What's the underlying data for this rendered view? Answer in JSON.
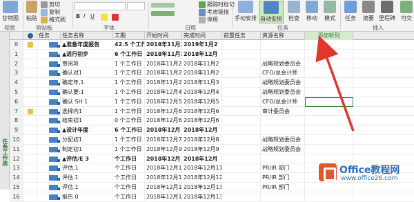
{
  "ribbon": {
    "gantt_label": "甘特图",
    "paste_label": "粘贴",
    "cut_label": "剪切",
    "copy_label": "复制",
    "format_painter_label": "格式刷",
    "group_view": "视图",
    "group_clipboard": "剪贴板",
    "group_font": "字体",
    "group_schedule": "日程",
    "group_tasks": "任务",
    "group_insert": "插入",
    "mark_on_track": "跟踪时标记",
    "respect_links": "考虑链接",
    "inactivate": "停用",
    "manual_schedule": "手动安排",
    "auto_schedule": "自动安排",
    "inspect": "检查",
    "move": "移动",
    "mode": "模式",
    "task": "任务",
    "summary": "摘要",
    "milestone": "里程碑",
    "deliverable": "可交"
  },
  "grid": {
    "headers": {
      "mode": "任务",
      "name": "任务名称",
      "duration": "工期",
      "start": "开始时间",
      "finish": "完成时间",
      "predecessors": "前置任务",
      "resource": "资源名称",
      "add_column": "添加新列"
    },
    "side_label": "任务工作表",
    "rows": [
      {
        "num": "0",
        "name": "▲准备年度报告",
        "dur": "42.5 个工作日",
        "start": "2018年11月2",
        "finish": "2019年1月2",
        "pred": "",
        "res": "",
        "summary": true
      },
      {
        "num": "1",
        "name": "▲进行初步",
        "dur": "6 个工作日",
        "start": "2018年11月2",
        "finish": "2018年12月",
        "pred": "",
        "res": "",
        "summary": true
      },
      {
        "num": "2",
        "name": "审阅项",
        "dur": "1 个工作日",
        "start": "2018年11月2",
        "finish": "2018年11月2",
        "pred": "",
        "res": "战略规划委员会",
        "summary": false
      },
      {
        "num": "3",
        "name": "确认对1",
        "dur": "1 个工作日",
        "start": "2018年11月2",
        "finish": "2018年11月2",
        "pred": "",
        "res": "CFO/总会计师",
        "summary": false
      },
      {
        "num": "4",
        "name": "确定年,1",
        "dur": "1 个工作日",
        "start": "2018年11月2",
        "finish": "2018年11月3",
        "pred": "",
        "res": "战略规划委员会",
        "summary": false
      },
      {
        "num": "5",
        "name": "确认要:1",
        "dur": "1 个工作日",
        "start": "2018年12月4",
        "finish": "2018年12月4",
        "pred": "",
        "res": "战略规划委员会",
        "summary": false
      },
      {
        "num": "6",
        "name": "确认 SH 1",
        "dur": "1 个工作日",
        "start": "2018年12月5",
        "finish": "2018年12月5",
        "pred": "",
        "res": "CFO/总会计师",
        "summary": false
      },
      {
        "num": "7",
        "name": "选择内1",
        "dur": "1 个工作日",
        "start": "2018年12月6",
        "finish": "2018年12月6",
        "pred": "",
        "res": "审计委员会",
        "summary": false
      },
      {
        "num": "8",
        "name": "结束初1",
        "dur": "0 个工作日",
        "start": "2018年12月6",
        "finish": "2018年12月6",
        "pred": "",
        "res": "",
        "summary": false
      },
      {
        "num": "9",
        "name": "▲设计年度",
        "dur": "6 个工作日",
        "start": "2018年12月",
        "finish": "2018年12月",
        "pred": "",
        "res": "",
        "summary": true
      },
      {
        "num": "10",
        "name": "分配初1",
        "dur": "1 个工作日",
        "start": "2018年12月7",
        "finish": "2018年12月8",
        "pred": "",
        "res": "战略规划委员会",
        "summary": false
      },
      {
        "num": "11",
        "name": "制定初1",
        "dur": "1 个工作日",
        "start": "2018年12月9",
        "finish": "2018年12月9",
        "pred": "",
        "res": "战略规划委员会",
        "summary": false
      },
      {
        "num": "12",
        "name": "▲评估/E 3",
        "dur": "个工作日",
        "start": "2018年12月",
        "finish": "2018年12月",
        "pred": "",
        "res": "",
        "summary": true
      },
      {
        "num": "13",
        "name": "评估,1",
        "dur": "个工作日",
        "start": "2018年12月11",
        "finish": "2018年12月11",
        "pred": "",
        "res": "PR/IR 部门",
        "summary": false
      },
      {
        "num": "14",
        "name": "评估.1",
        "dur": "个工作日",
        "start": "2018年12月12",
        "finish": "2018年12月12",
        "pred": "",
        "res": "PR/IR 部门",
        "summary": false
      },
      {
        "num": "15",
        "name": "评估.1",
        "dur": "个工作日",
        "start": "2018年12月13",
        "finish": "2018年12月13",
        "pred": "",
        "res": "PR/IR 部门",
        "summary": false
      },
      {
        "num": "16",
        "name": "报告 0",
        "dur": "个工作日",
        "start": "2018年12月13",
        "finish": "2018年12月13",
        "pred": "",
        "res": "",
        "summary": false
      }
    ]
  },
  "watermark": {
    "title": "Office教程网",
    "url": "www.office26.com"
  },
  "colors": {
    "accent_green": "#2a8a38",
    "arrow_red": "#e0362c",
    "mode_icon_blue": "#4a7fc1"
  }
}
